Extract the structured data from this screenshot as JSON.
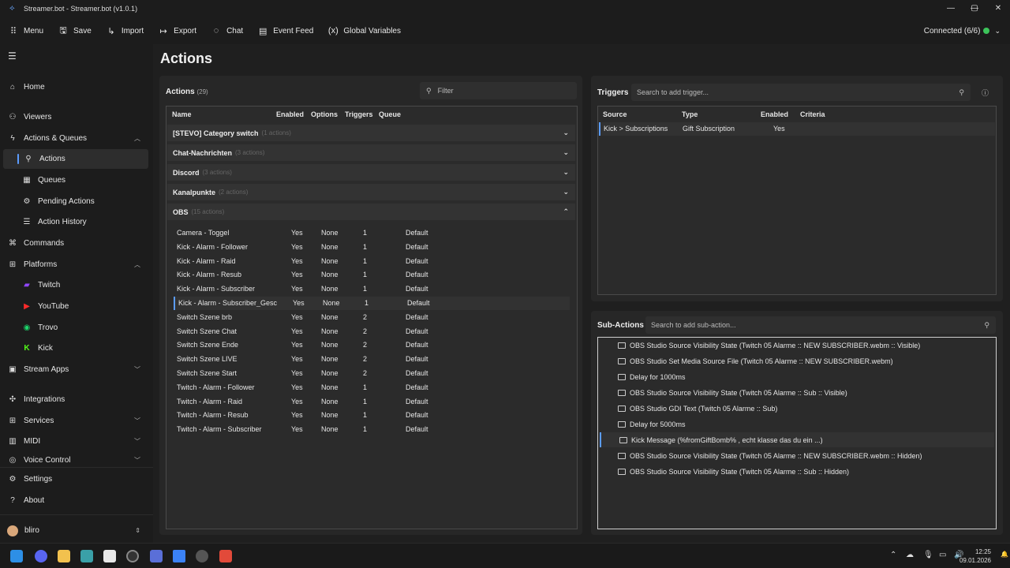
{
  "window": {
    "title": "Streamer.bot - Streamer.bot (v1.0.1)",
    "min": "—",
    "max": "▢",
    "close": "✕"
  },
  "toolbar": {
    "menu": "Menu",
    "save": "Save",
    "import": "Import",
    "export": "Export",
    "chat": "Chat",
    "event_feed": "Event Feed",
    "global_variables": "Global Variables",
    "connected": "Connected (6/6)",
    "connected_color": "#3cc35a"
  },
  "sidebar": {
    "home": "Home",
    "viewers": "Viewers",
    "actions_queues": "Actions & Queues",
    "actions": "Actions",
    "queues": "Queues",
    "pending_actions": "Pending Actions",
    "action_history": "Action History",
    "commands": "Commands",
    "platforms": "Platforms",
    "twitch": "Twitch",
    "youtube": "YouTube",
    "trovo": "Trovo",
    "kick": "Kick",
    "stream_apps": "Stream Apps",
    "integrations": "Integrations",
    "services": "Services",
    "midi": "MIDI",
    "voice_control": "Voice Control",
    "settings": "Settings",
    "about": "About",
    "user": "bliro"
  },
  "main": {
    "title": "Actions"
  },
  "actions_panel": {
    "label": "Actions",
    "count": "(29)",
    "filter_placeholder": "Filter",
    "headers": {
      "name": "Name",
      "enabled": "Enabled",
      "options": "Options",
      "triggers": "Triggers",
      "queue": "Queue"
    },
    "groups": [
      {
        "name": "[STEVO] Category switch",
        "count": "(1 actions)"
      },
      {
        "name": "Chat-Nachrichten",
        "count": "(3 actions)"
      },
      {
        "name": "Discord",
        "count": "(3 actions)"
      },
      {
        "name": "Kanalpunkte",
        "count": "(2 actions)"
      },
      {
        "name": "OBS",
        "count": "(15 actions)"
      }
    ],
    "rows": [
      {
        "name": "Camera - Toggel",
        "enabled": "Yes",
        "options": "None",
        "triggers": "1",
        "queue": "Default"
      },
      {
        "name": "Kick - Alarm - Follower",
        "enabled": "Yes",
        "options": "None",
        "triggers": "1",
        "queue": "Default"
      },
      {
        "name": "Kick - Alarm - Raid",
        "enabled": "Yes",
        "options": "None",
        "triggers": "1",
        "queue": "Default"
      },
      {
        "name": "Kick - Alarm - Resub",
        "enabled": "Yes",
        "options": "None",
        "triggers": "1",
        "queue": "Default"
      },
      {
        "name": "Kick - Alarm - Subscriber",
        "enabled": "Yes",
        "options": "None",
        "triggers": "1",
        "queue": "Default"
      },
      {
        "name": "Kick - Alarm - Subscriber_Gesc",
        "enabled": "Yes",
        "options": "None",
        "triggers": "1",
        "queue": "Default"
      },
      {
        "name": "Switch Szene brb",
        "enabled": "Yes",
        "options": "None",
        "triggers": "2",
        "queue": "Default"
      },
      {
        "name": "Switch Szene Chat",
        "enabled": "Yes",
        "options": "None",
        "triggers": "2",
        "queue": "Default"
      },
      {
        "name": "Switch Szene Ende",
        "enabled": "Yes",
        "options": "None",
        "triggers": "2",
        "queue": "Default"
      },
      {
        "name": "Switch Szene LIVE",
        "enabled": "Yes",
        "options": "None",
        "triggers": "2",
        "queue": "Default"
      },
      {
        "name": "Switch Szene Start",
        "enabled": "Yes",
        "options": "None",
        "triggers": "2",
        "queue": "Default"
      },
      {
        "name": "Twitch - Alarm - Follower",
        "enabled": "Yes",
        "options": "None",
        "triggers": "1",
        "queue": "Default"
      },
      {
        "name": "Twitch - Alarm - Raid",
        "enabled": "Yes",
        "options": "None",
        "triggers": "1",
        "queue": "Default"
      },
      {
        "name": "Twitch - Alarm - Resub",
        "enabled": "Yes",
        "options": "None",
        "triggers": "1",
        "queue": "Default"
      },
      {
        "name": "Twitch - Alarm - Subscriber",
        "enabled": "Yes",
        "options": "None",
        "triggers": "1",
        "queue": "Default"
      }
    ]
  },
  "triggers_panel": {
    "label": "Triggers",
    "search_placeholder": "Search to add trigger...",
    "headers": {
      "source": "Source",
      "type": "Type",
      "enabled": "Enabled",
      "criteria": "Criteria"
    },
    "rows": [
      {
        "source": "Kick > Subscriptions",
        "type": "Gift Subscription",
        "enabled": "Yes",
        "criteria": ""
      }
    ]
  },
  "subactions_panel": {
    "label": "Sub-Actions",
    "search_placeholder": "Search to add sub-action...",
    "items": [
      "OBS Studio Source Visibility State (Twitch 05 Alarme :: NEW SUBSCRIBER.webm :: Visible)",
      "OBS Studio Set Media Source File (Twitch 05 Alarme :: NEW SUBSCRIBER.webm)",
      "Delay for 1000ms",
      "OBS Studio Source Visibility State (Twitch 05 Alarme :: Sub :: Visible)",
      "OBS Studio GDI Text (Twitch 05 Alarme :: Sub)",
      "Delay for 5000ms",
      "Kick Message (%fromGiftBomb% , echt klasse das du ein ...)",
      "OBS Studio Source Visibility State (Twitch 05 Alarme :: NEW SUBSCRIBER.webm :: Hidden)",
      "OBS Studio Source Visibility State (Twitch 05 Alarme :: Sub :: Hidden)"
    ]
  },
  "taskbar": {
    "time": "12:25",
    "date": "09.01.2026"
  }
}
